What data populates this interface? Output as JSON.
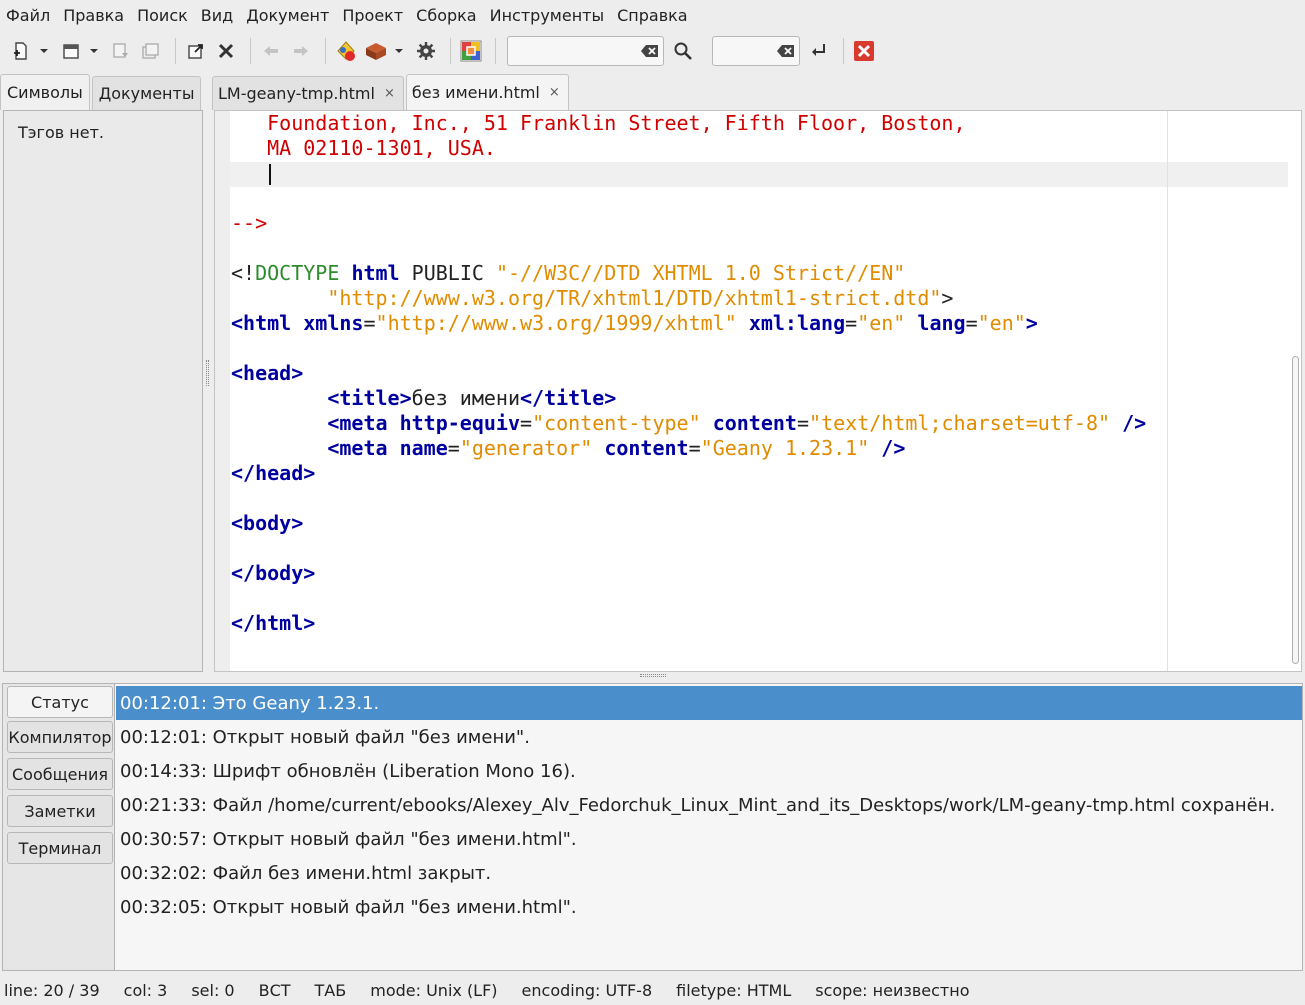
{
  "menu": [
    "Файл",
    "Правка",
    "Поиск",
    "Вид",
    "Документ",
    "Проект",
    "Сборка",
    "Инструменты",
    "Справка"
  ],
  "toolbar": {
    "icons": [
      "new-document-icon",
      "open-file-icon",
      "save-icon",
      "save-all-icon",
      "reload-icon",
      "close-file-icon",
      "back-icon",
      "forward-icon",
      "compile-icon",
      "build-icon",
      "preferences-icon",
      "color-chooser-icon",
      "search-icon",
      "jump-to-line-icon",
      "quit-icon"
    ],
    "search_value": "",
    "goto_value": ""
  },
  "sidebar": {
    "tabs": [
      "Символы",
      "Документы"
    ],
    "active_tab": 0,
    "empty_text": "Тэгов нет."
  },
  "editor": {
    "tabs": [
      {
        "label": "LM-geany-tmp.html",
        "close": "×"
      },
      {
        "label": "без имени.html",
        "close": "×"
      }
    ],
    "active_tab": 1
  },
  "code_lines": [
    [
      [
        "   Foundation, Inc., 51 Franklin Street, Fifth Floor, Boston,",
        "com"
      ]
    ],
    [
      [
        "   MA 02110-1301, USA.",
        "com"
      ]
    ],
    [
      [
        "",
        "txt"
      ]
    ],
    [
      [
        "",
        "txt"
      ]
    ],
    [
      [
        "-->",
        "com"
      ]
    ],
    [
      [
        "",
        "txt"
      ]
    ],
    [
      [
        "<!",
        "txt"
      ],
      [
        "DOCTYPE",
        "dt"
      ],
      [
        " ",
        "txt"
      ],
      [
        "html",
        "dtk"
      ],
      [
        " PUBLIC ",
        "txt"
      ],
      [
        "\"-//W3C//DTD XHTML 1.0 Strict//EN\"",
        "str"
      ]
    ],
    [
      [
        "        ",
        "txt"
      ],
      [
        "\"http://www.w3.org/TR/xhtml1/DTD/xhtml1-strict.dtd\"",
        "str"
      ],
      [
        ">",
        "txt"
      ]
    ],
    [
      [
        "<html",
        "tag"
      ],
      [
        " ",
        "txt"
      ],
      [
        "xmlns",
        "attr"
      ],
      [
        "=",
        "txt"
      ],
      [
        "\"http://www.w3.org/1999/xhtml\"",
        "str"
      ],
      [
        " ",
        "txt"
      ],
      [
        "xml:lang",
        "attr"
      ],
      [
        "=",
        "txt"
      ],
      [
        "\"en\"",
        "str"
      ],
      [
        " ",
        "txt"
      ],
      [
        "lang",
        "attr"
      ],
      [
        "=",
        "txt"
      ],
      [
        "\"en\"",
        "str"
      ],
      [
        ">",
        "tag"
      ]
    ],
    [
      [
        "",
        "txt"
      ]
    ],
    [
      [
        "<head>",
        "tag"
      ]
    ],
    [
      [
        "        ",
        "txt"
      ],
      [
        "<title>",
        "tag"
      ],
      [
        "без имени",
        "txt"
      ],
      [
        "</title>",
        "tag"
      ]
    ],
    [
      [
        "        ",
        "txt"
      ],
      [
        "<meta",
        "tag"
      ],
      [
        " ",
        "txt"
      ],
      [
        "http-equiv",
        "attr"
      ],
      [
        "=",
        "txt"
      ],
      [
        "\"content-type\"",
        "str"
      ],
      [
        " ",
        "txt"
      ],
      [
        "content",
        "attr"
      ],
      [
        "=",
        "txt"
      ],
      [
        "\"text/html;charset=utf-8\"",
        "str"
      ],
      [
        " ",
        "txt"
      ],
      [
        "/>",
        "tag"
      ]
    ],
    [
      [
        "        ",
        "txt"
      ],
      [
        "<meta",
        "tag"
      ],
      [
        " ",
        "txt"
      ],
      [
        "name",
        "attr"
      ],
      [
        "=",
        "txt"
      ],
      [
        "\"generator\"",
        "str"
      ],
      [
        " ",
        "txt"
      ],
      [
        "content",
        "attr"
      ],
      [
        "=",
        "txt"
      ],
      [
        "\"Geany 1.23.1\"",
        "str"
      ],
      [
        " ",
        "txt"
      ],
      [
        "/>",
        "tag"
      ]
    ],
    [
      [
        "</head>",
        "tag"
      ]
    ],
    [
      [
        "",
        "txt"
      ]
    ],
    [
      [
        "<body>",
        "tag"
      ]
    ],
    [
      [
        "",
        "txt"
      ]
    ],
    [
      [
        "</body>",
        "tag"
      ]
    ],
    [
      [
        "",
        "txt"
      ]
    ],
    [
      [
        "</html>",
        "tag"
      ]
    ]
  ],
  "messages": {
    "tabs": [
      "Статус",
      "Компилятор",
      "Сообщения",
      "Заметки",
      "Терминал"
    ],
    "active_tab": 0,
    "lines": [
      "00:12:01: Это Geany 1.23.1.",
      "00:12:01: Открыт новый файл \"без имени\".",
      "00:14:33: Шрифт обновлён (Liberation Mono 16).",
      "00:21:33: Файл /home/current/ebooks/Alexey_Alv_Fedorchuk_Linux_Mint_and_its_Desktops/work/LM-geany-tmp.html сохранён.",
      "00:30:57: Открыт новый файл \"без имени.html\".",
      "00:32:02: Файл без имени.html закрыт.",
      "00:32:05: Открыт новый файл \"без имени.html\"."
    ],
    "selected": 0
  },
  "status": {
    "line": "line: 20 / 39",
    "col": "col: 3",
    "sel": "sel: 0",
    "ins": "ВСТ",
    "tab": "ТАБ",
    "mode": "mode: Unix (LF)",
    "encoding": "encoding: UTF-8",
    "filetype": "filetype: HTML",
    "scope": "scope: неизвестно"
  },
  "colors": {
    "comment": "#d00000",
    "tag": "#0000a0",
    "string": "#e08c00",
    "doctype": "#2c8c2c",
    "selection": "#4a8fcb",
    "quit": "#d83a2e"
  }
}
